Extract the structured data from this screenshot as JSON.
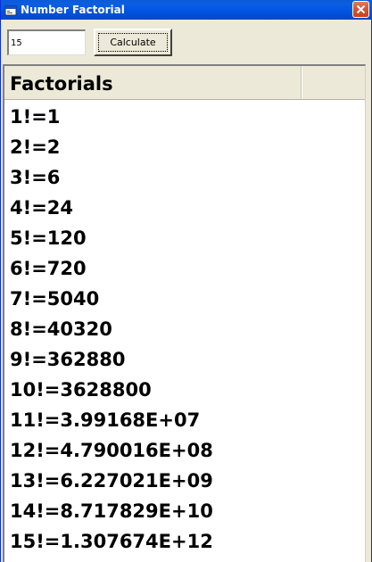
{
  "window": {
    "title": "Number Factorial",
    "icon": "app-window-icon",
    "close_icon": "close-icon"
  },
  "input": {
    "value": "15"
  },
  "button": {
    "label": "Calculate"
  },
  "list": {
    "columns": [
      "Factorials",
      ""
    ],
    "rows": [
      "1!=1",
      "2!=2",
      "3!=6",
      "4!=24",
      "5!=120",
      "6!=720",
      "7!=5040",
      "8!=40320",
      "9!=362880",
      "10!=3628800",
      "11!=3.99168E+07",
      "12!=4.790016E+08",
      "13!=6.227021E+09",
      "14!=8.717829E+10",
      "15!=1.307674E+12"
    ]
  },
  "colors": {
    "titlebar": "#0053e1",
    "title_text": "#ffffff",
    "close_button": "#d3542e",
    "window_bg": "#ece9d8",
    "list_bg": "#ffffff"
  }
}
